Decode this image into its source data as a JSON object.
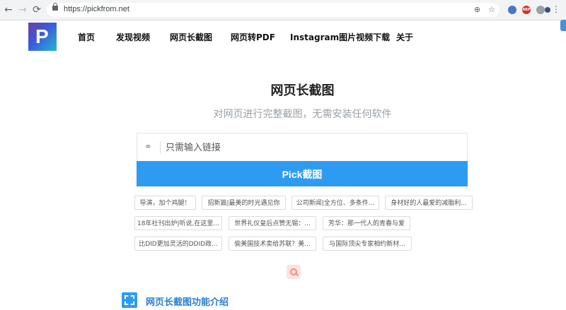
{
  "browser": {
    "url": "https://pickfrom.net",
    "back_icon": "←",
    "forward_icon": "→",
    "reload_icon": "⟳",
    "zoom_icon": "⊕",
    "bookmark_icon": "☆",
    "abp_label": "ABP",
    "menu_icon": "⋮"
  },
  "header": {
    "logo_letter": "P",
    "nav": [
      "首页",
      "发现视频",
      "网页长截图",
      "网页转PDF",
      "Instagram图片视频下载",
      "关于"
    ]
  },
  "main": {
    "title": "网页长截图",
    "subtitle": "对网页进行完整截图，无需安装任何软件",
    "search_placeholder": "只需输入链接",
    "pick_label": "Pick截图",
    "link_icon": "⚭"
  },
  "suggestions": [
    [
      "导演，加个鸡腿！",
      "招新篇|最美的时光遇见你",
      "公司新闻|全方位、多条件...",
      "身材好的人最爱的减脂利..."
    ],
    [
      "18年社刊出炉|听说,在这里...",
      "世界礼仪皇后点赞无锡：...",
      "芳华：那一代人的青春与爱"
    ],
    [
      "比DID更加灵活的DDID政...",
      "偷美国技术卖给苏联？美...",
      "与国际顶尖专家相约新材..."
    ]
  ],
  "feature": {
    "title": "网页长截图功能介绍"
  },
  "colors": {
    "primary": "#2d9cf0",
    "logo_gradient": [
      "#6b3fa0",
      "#3b5bdb",
      "#22b8cf"
    ]
  }
}
